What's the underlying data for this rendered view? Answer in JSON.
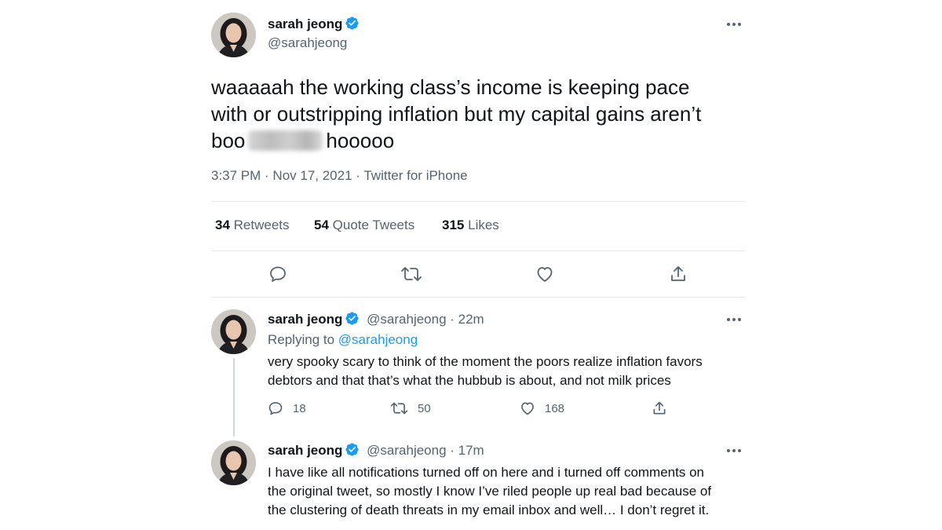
{
  "main_tweet": {
    "author_name": "sarah jeong",
    "author_handle": "@sarahjeong",
    "text_line1": "waaaaah the working class’s income is keeping pace",
    "text_line2": "with or outstripping inflation but my capital gains aren’t",
    "text_line3_before": "boo",
    "text_line3_after": "hooooo",
    "timestamp": "3:37 PM · Nov 17, 2021 · Twitter for iPhone",
    "retweets_count": "34",
    "retweets_label": "Retweets",
    "quote_count": "54",
    "quote_label": "Quote Tweets",
    "likes_count": "315",
    "likes_label": "Likes"
  },
  "reply1": {
    "author_name": "sarah jeong",
    "handle_time": "@sarahjeong · 22m",
    "replying_prefix": "Replying to",
    "replying_to": "@sarahjeong",
    "text_line1": "very spooky scary to think of the moment the poors realize inflation favors",
    "text_line2": "debtors and that that’s what the hubbub is about, and not milk prices",
    "reply_count": "18",
    "retweet_count": "50",
    "like_count": "168"
  },
  "reply2": {
    "author_name": "sarah jeong",
    "handle_time": "@sarahjeong · 17m",
    "text_line1": "I have like all notifications turned off on here and i turned off comments on",
    "text_line2": "the original tweet, so mostly I know I’ve riled people up real bad because of",
    "text_line3": "the clustering of death threats in my email inbox and well… I don’t regret it."
  },
  "icons": {
    "verified": "verified-badge-icon",
    "more": "more-options-icon",
    "reply": "reply-icon",
    "retweet": "retweet-icon",
    "like": "like-icon",
    "share": "share-icon"
  },
  "colors": {
    "accent": "#1d9bf0",
    "text": "#0f1419",
    "secondary": "#536471",
    "divider": "#e6e9eb"
  }
}
